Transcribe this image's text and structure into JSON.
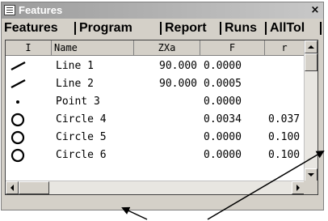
{
  "window": {
    "title": "Features",
    "close_glyph": "×"
  },
  "tabs": [
    "Features",
    "Program",
    "Report",
    "Runs",
    "AllTol"
  ],
  "columns": [
    "I",
    "Name",
    "ZXa",
    "F",
    "r"
  ],
  "rows": [
    {
      "icon": "line-icon",
      "name": "Line 1",
      "zxa": "90.000",
      "f": "0.0000",
      "r": ""
    },
    {
      "icon": "line-icon",
      "name": "Line 2",
      "zxa": "90.000",
      "f": "0.0005",
      "r": ""
    },
    {
      "icon": "point-icon",
      "name": "Point 3",
      "zxa": "",
      "f": "0.0000",
      "r": ""
    },
    {
      "icon": "circle-icon",
      "name": "Circle 4",
      "zxa": "",
      "f": "0.0034",
      "r": "0.037"
    },
    {
      "icon": "circle-icon",
      "name": "Circle 5",
      "zxa": "",
      "f": "0.0000",
      "r": "0.100"
    },
    {
      "icon": "circle-icon",
      "name": "Circle 6",
      "zxa": "",
      "f": "0.0000",
      "r": "0.100"
    }
  ],
  "colors": {
    "titlebar_start": "#9c9c9c",
    "titlebar_end": "#c8c8c8",
    "chrome": "#d4d0c8"
  }
}
